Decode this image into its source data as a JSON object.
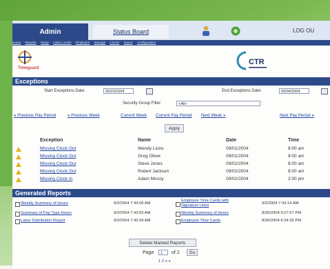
{
  "tabs": {
    "admin": "Admin",
    "status": "Status Board",
    "logout": "LOG OU"
  },
  "nav_links": [
    "Home",
    "Reports",
    "Setup",
    "Labor Levels",
    "Employee",
    "Manage",
    "Clocks",
    "Import",
    "Configuration"
  ],
  "logos": {
    "left": "Timeguard",
    "right": "CTR"
  },
  "exceptions": {
    "title": "Exceptions",
    "start_label": "Start Exceptions Date:",
    "start_value": "09/20/2004",
    "end_label": "End Exceptions Date:",
    "end_value": "09/04/2004",
    "filter_label": "Security Group Filter:",
    "filter_value": "<All>",
    "nav": [
      "Previous Pay Period",
      "Previous Week",
      "Current Week",
      "Current Pay Period",
      "Next Week",
      "Next Pay Period"
    ],
    "apply": "Apply",
    "columns": [
      "Exception",
      "Name",
      "Date",
      "Time"
    ],
    "rows": [
      {
        "exception": "Missing Clock Out",
        "name": "Wendy Lions",
        "date": "09/01/2004",
        "time": "8:00 am"
      },
      {
        "exception": "Missing Clock Out",
        "name": "Greg Oliver",
        "date": "09/01/2004",
        "time": "8:00 am"
      },
      {
        "exception": "Missing Clock Out",
        "name": "Steve Jones",
        "date": "09/02/2004",
        "time": "8:00 am"
      },
      {
        "exception": "Missing Clock Out",
        "name": "Robert Jackson",
        "date": "09/02/2004",
        "time": "8:00 am"
      },
      {
        "exception": "Missing Clock In",
        "name": "Adam Mccoy",
        "date": "09/02/2004",
        "time": "2:00 pm"
      }
    ]
  },
  "generated": {
    "title": "Generated Reports",
    "left": [
      {
        "name": "Weekly Summary of Hours",
        "time": "9/2/2004 7:44:06 AM"
      },
      {
        "name": "Summary of Pay Type Hours",
        "time": "9/2/2004 7:43:55 AM"
      },
      {
        "name": "Labor Distribution Report",
        "time": "9/2/2004 7:43:34 AM"
      }
    ],
    "right": [
      {
        "name": "Employee Time Cards with Signature Lines",
        "time": "9/2/2004 7:43:14 AM"
      },
      {
        "name": "Weekly Summary of Hours",
        "time": "8/26/2004 9:27:57 PM"
      },
      {
        "name": "Employee Time Cards",
        "time": "8/26/2004 6:34:35 PM"
      }
    ],
    "delete": "Delete Marked Reports",
    "page_label": "Page",
    "page_value": "1",
    "of_total": "of 2",
    "go": "Go",
    "pages": "1 2"
  }
}
